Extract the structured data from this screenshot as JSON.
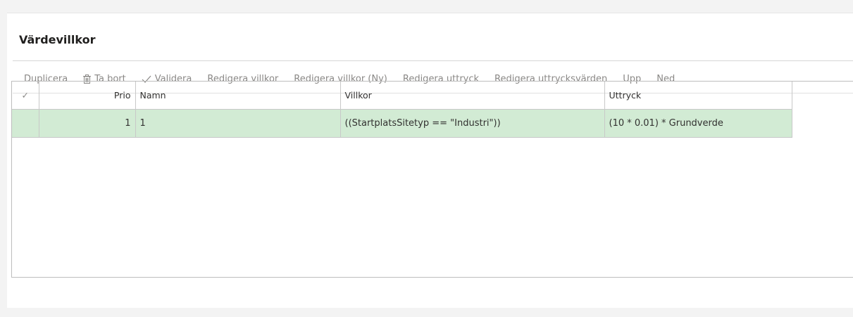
{
  "section": {
    "title": "Värdevillkor"
  },
  "toolbar": {
    "duplicate_label": "Duplicera",
    "delete_label": "Ta bort",
    "validate_label": "Validera",
    "edit_condition_label": "Redigera villkor",
    "edit_condition_new_label": "Redigera villkor (Ny)",
    "edit_expression_label": "Redigera uttryck",
    "edit_expression_values_label": "Redigera uttrycksvärden",
    "up_label": "Upp",
    "down_label": "Ned"
  },
  "grid": {
    "columns": {
      "select": "✓",
      "prio": "Prio",
      "name": "Namn",
      "condition": "Villkor",
      "expression": "Uttryck"
    },
    "rows": [
      {
        "prio": "1",
        "name": "1",
        "condition": "((StartplatsSitetyp == \"Industri\"))",
        "expression": "(10 * 0.01) * Grundverde"
      }
    ]
  },
  "colors": {
    "selected_row": "#d2ebd4",
    "toolbar_text": "#8a8886"
  }
}
